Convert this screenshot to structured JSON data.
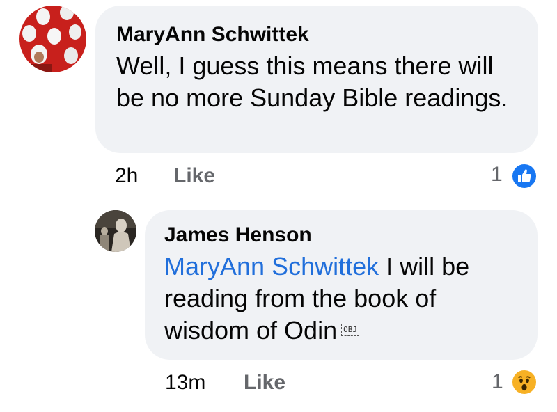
{
  "comments": [
    {
      "author": "MaryAnn Schwittek",
      "text": "Well, I guess this means there will be no more Sunday Bible readings.",
      "time": "2h",
      "like_label": "Like",
      "reaction_count": "1",
      "reaction_icon": "like-icon"
    },
    {
      "author": "James Henson",
      "mention": "MaryAnn Schwittek",
      "text": " I will be reading from the book of wisdom of Odin",
      "object_marker": "OBJ",
      "time": "13m",
      "like_label": "Like",
      "reaction_count": "1",
      "reaction_icon": "wow-icon"
    }
  ],
  "colors": {
    "bubble_bg": "#f0f2f5",
    "mention": "#216fdb",
    "like_blue": "#1877f2",
    "wow_yellow": "#f7b125",
    "meta_gray": "#65676b"
  }
}
